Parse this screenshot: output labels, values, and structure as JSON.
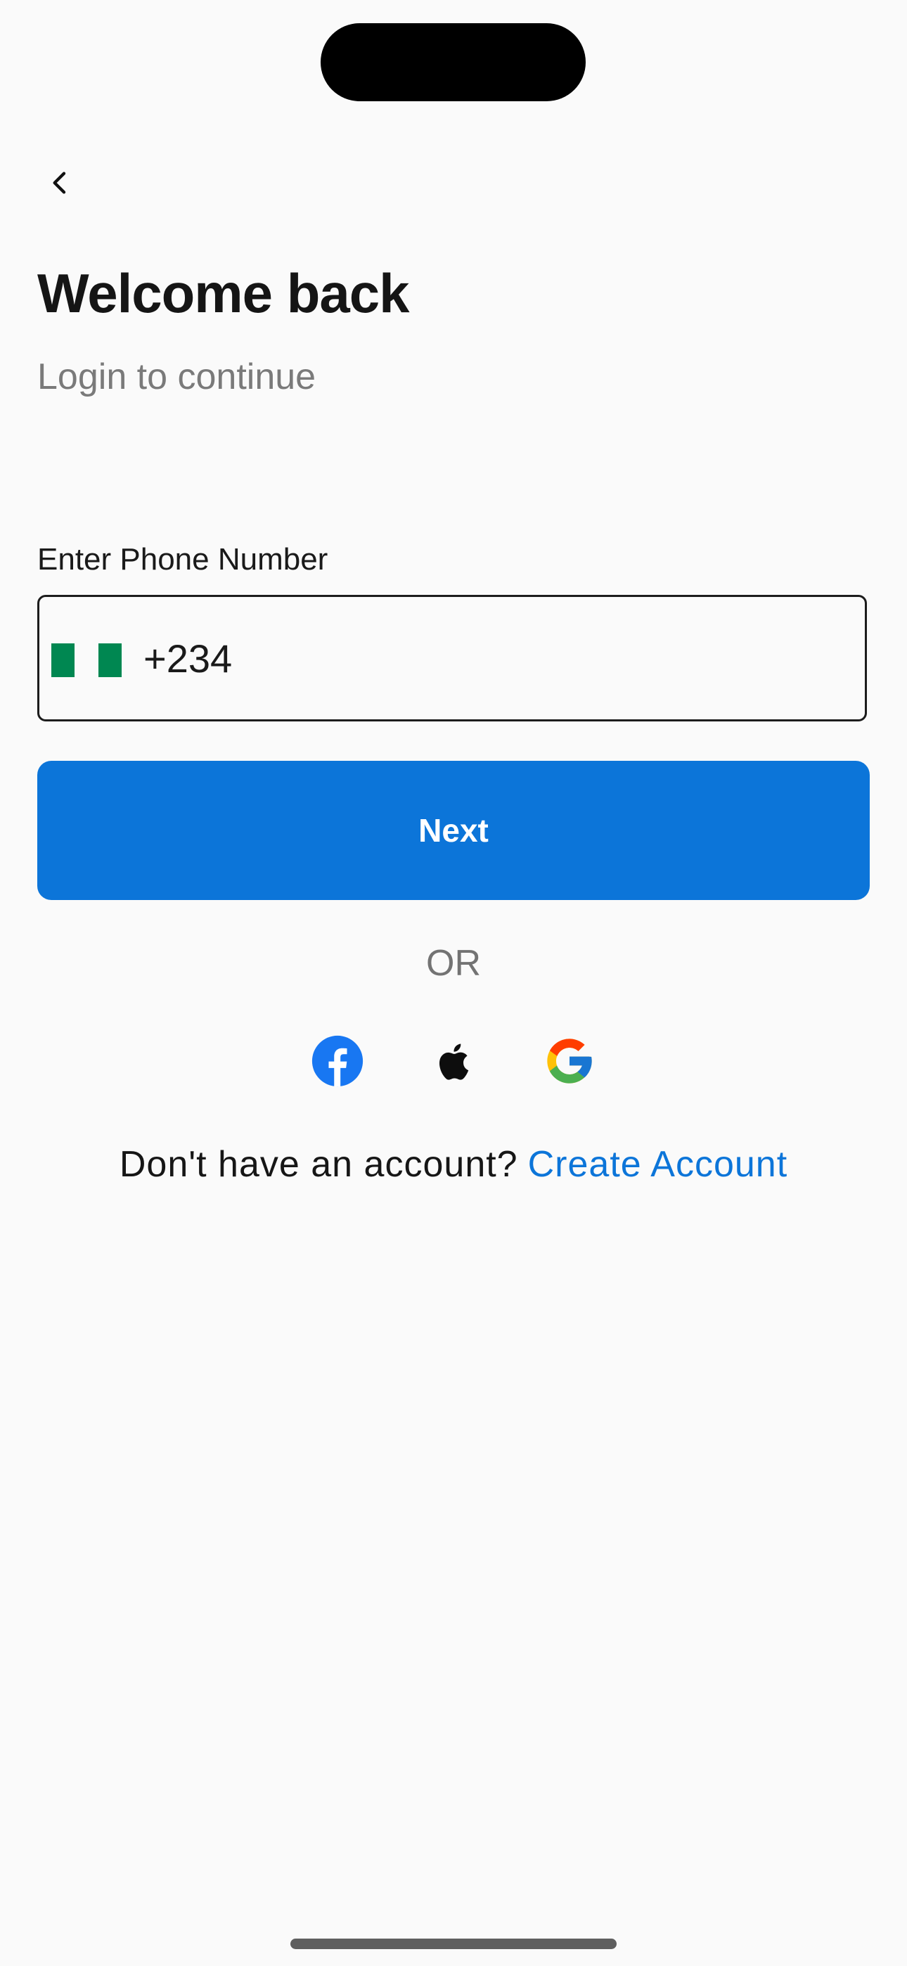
{
  "header": {
    "back_icon": "chevron-left-icon"
  },
  "page": {
    "title": "Welcome back",
    "subtitle": "Login to continue"
  },
  "phone": {
    "label": "Enter Phone Number",
    "country_flag": "nigeria-flag-icon",
    "dial_code": "+234",
    "value": ""
  },
  "actions": {
    "next_label": "Next",
    "or_label": "OR"
  },
  "social": {
    "facebook_icon": "facebook-icon",
    "apple_icon": "apple-icon",
    "google_icon": "google-icon"
  },
  "signup": {
    "prompt": "Don't have an account?",
    "link": "Create Account"
  },
  "colors": {
    "background": "#fafafa",
    "accent": "#0c75d9",
    "flag_green": "#008751",
    "facebook_blue": "#1877f2"
  }
}
